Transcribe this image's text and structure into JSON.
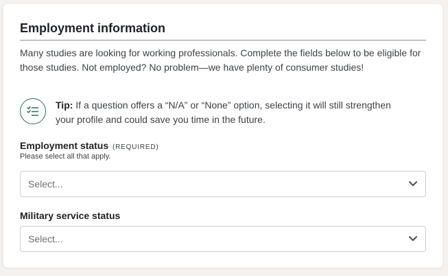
{
  "section": {
    "title": "Employment information",
    "intro": "Many studies are looking for working professionals. Complete the fields below to be eligible for those studies. Not employed? No problem—we have plenty of consumer studies!"
  },
  "tip": {
    "label": "Tip:",
    "text": " If a question offers a “N/A” or “None” option, selecting it will still strengthen your profile and could save you time in the future.",
    "icon": "checklist-icon"
  },
  "employment_status": {
    "label": "Employment status",
    "required_tag": "(REQUIRED)",
    "helper": "Please select all that apply.",
    "placeholder": "Select..."
  },
  "military_status": {
    "label": "Military service status",
    "placeholder": "Select..."
  },
  "colors": {
    "accent": "#2a6b5b",
    "background": "#f5f1ee",
    "card": "#ffffff",
    "border": "#cfcfcf"
  }
}
